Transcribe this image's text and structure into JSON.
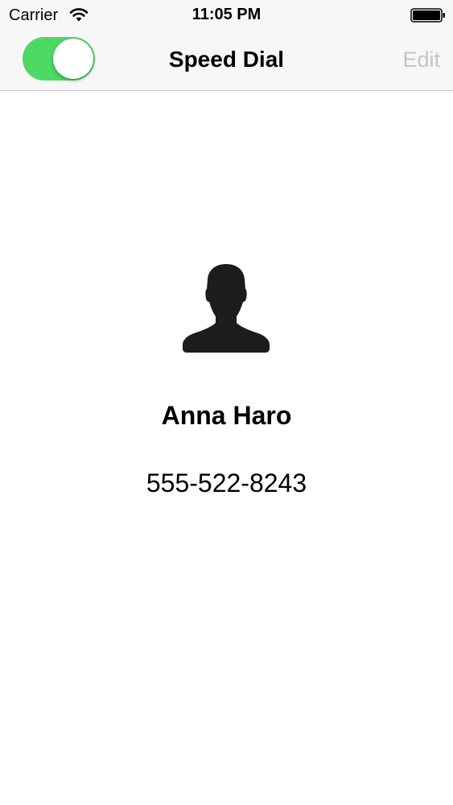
{
  "status_bar": {
    "carrier": "Carrier",
    "time": "11:05 PM",
    "wifi_icon": "wifi-icon",
    "battery_icon": "battery-icon"
  },
  "nav_bar": {
    "title": "Speed Dial",
    "edit_label": "Edit",
    "toggle_on": true,
    "toggle_color": "#4cd964",
    "edit_color": "#c4c4c6"
  },
  "contact": {
    "avatar_icon": "person-silhouette-icon",
    "name": "Anna Haro",
    "phone": "555-522-8243"
  }
}
